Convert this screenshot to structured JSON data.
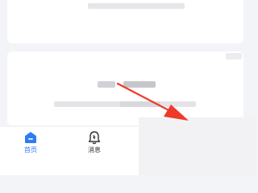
{
  "tabbar": {
    "tabs": [
      {
        "label": "首页",
        "icon": "home-icon",
        "active": true
      },
      {
        "label": "消息",
        "icon": "bell-icon",
        "active": false
      }
    ],
    "active_color": "#2f7cf6"
  },
  "annotation": {
    "arrow_color": "#ee3a2a"
  }
}
